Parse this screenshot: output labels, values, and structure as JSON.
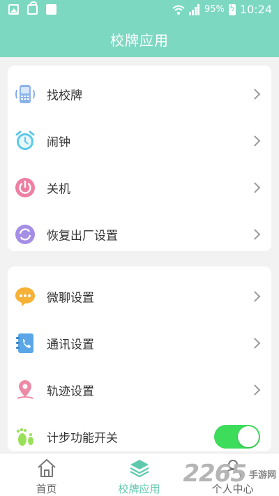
{
  "status_bar": {
    "battery": "95%",
    "time": "10:24"
  },
  "header": {
    "title": "校牌应用"
  },
  "menu_group_1": [
    {
      "label": "找校牌",
      "icon": "phone-device-icon"
    },
    {
      "label": "闹钟",
      "icon": "alarm-clock-icon"
    },
    {
      "label": "关机",
      "icon": "power-icon"
    },
    {
      "label": "恢复出厂设置",
      "icon": "refresh-icon"
    }
  ],
  "menu_group_2": [
    {
      "label": "微聊设置",
      "icon": "chat-bubble-icon"
    },
    {
      "label": "通讯设置",
      "icon": "contact-book-icon"
    },
    {
      "label": "轨迹设置",
      "icon": "location-pin-icon"
    },
    {
      "label": "计步功能开关",
      "icon": "footprint-icon",
      "toggle_on": true
    }
  ],
  "tabbar": {
    "tabs": [
      {
        "label": "首页",
        "icon": "home-icon",
        "active": false
      },
      {
        "label": "校牌应用",
        "icon": "layers-icon",
        "active": true
      },
      {
        "label": "个人中心",
        "icon": "user-icon",
        "active": false
      }
    ]
  },
  "watermark": {
    "number": "2265",
    "text": "手游网"
  },
  "colors": {
    "header": "#7dd8c1",
    "accent": "#5fc9ae",
    "toggle_on": "#3ddc5a"
  }
}
